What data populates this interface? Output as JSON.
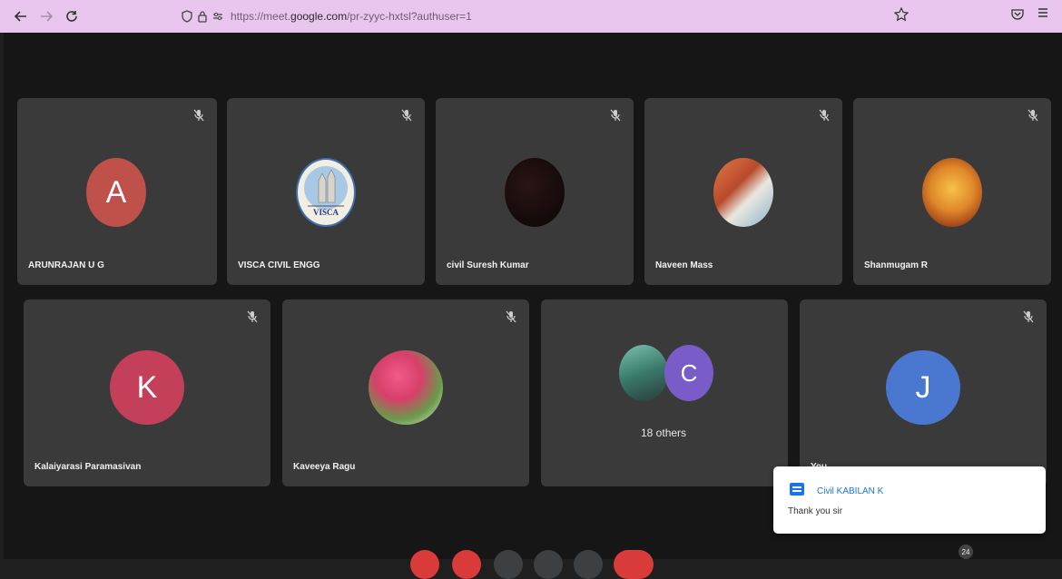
{
  "browser": {
    "back_icon": "arrow-left-icon",
    "forward_icon": "arrow-right-icon",
    "reload_icon": "reload-icon",
    "url_prefix": "https://meet.",
    "url_domain": "google.com",
    "url_rest": "/pr-zyyc-hxtsl?authuser=1",
    "bookmark_icon": "star-icon",
    "pocket_icon": "pocket-icon",
    "menu_icon": "hamburger-icon"
  },
  "participants": [
    {
      "name": "ARUNRAJAN U G",
      "initial": "A",
      "color": "#c0504a"
    },
    {
      "name": "VISCA CIVIL ENGG",
      "initial": "",
      "color": "#f3eee2",
      "avatar_text": "VISCA"
    },
    {
      "name": "civil Suresh Kumar",
      "initial": "",
      "color": "#0f0a0a"
    },
    {
      "name": "Naveen Mass",
      "initial": "",
      "color": "#c87050"
    },
    {
      "name": "Shanmugam R",
      "initial": "",
      "color": "#d88a2a"
    },
    {
      "name": "Kalaiyarasi Paramasivan",
      "initial": "K",
      "color": "#c4405a"
    },
    {
      "name": "Kaveeya Ragu",
      "initial": "",
      "color": "#d6406a"
    },
    {
      "name": "",
      "initial": "C",
      "color": "#7a5cc8",
      "others_label": "18 others"
    },
    {
      "name": "You",
      "initial": "J",
      "color": "#4a78d0"
    }
  ],
  "toast": {
    "sender": "Civil KABILAN K",
    "message": "Thank you sir",
    "icon": "chat-icon"
  },
  "controls": {
    "participant_count": "24"
  }
}
